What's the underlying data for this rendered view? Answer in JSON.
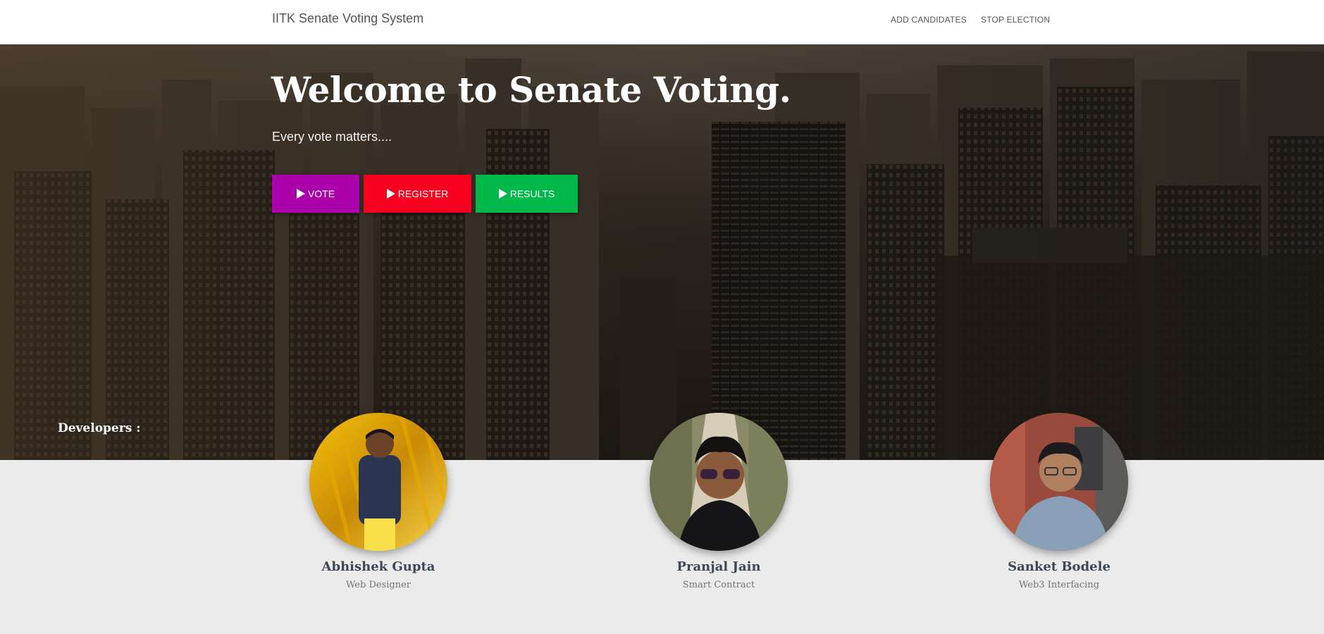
{
  "navbar": {
    "brand": "IITK Senate Voting System",
    "links": [
      {
        "label": "ADD CANDIDATES"
      },
      {
        "label": "STOP ELECTION"
      }
    ]
  },
  "hero": {
    "title": "Welcome to Senate Voting.",
    "subtitle": "Every vote matters....",
    "buttons": [
      {
        "label": "VOTE",
        "icon": "play-icon",
        "color": "#aa00aa"
      },
      {
        "label": "REGISTER",
        "icon": "play-icon",
        "color": "#f7001f"
      },
      {
        "label": "RESULTS",
        "icon": "play-icon",
        "color": "#00b74a"
      }
    ],
    "background": "city-skyline-photo"
  },
  "developers": {
    "heading": "Developers :",
    "members": [
      {
        "name": "Abhishek Gupta",
        "role": "Web Designer"
      },
      {
        "name": "Pranjal Jain",
        "role": "Smart Contract"
      },
      {
        "name": "Sanket Bodele",
        "role": "Web3 Interfacing"
      }
    ]
  }
}
